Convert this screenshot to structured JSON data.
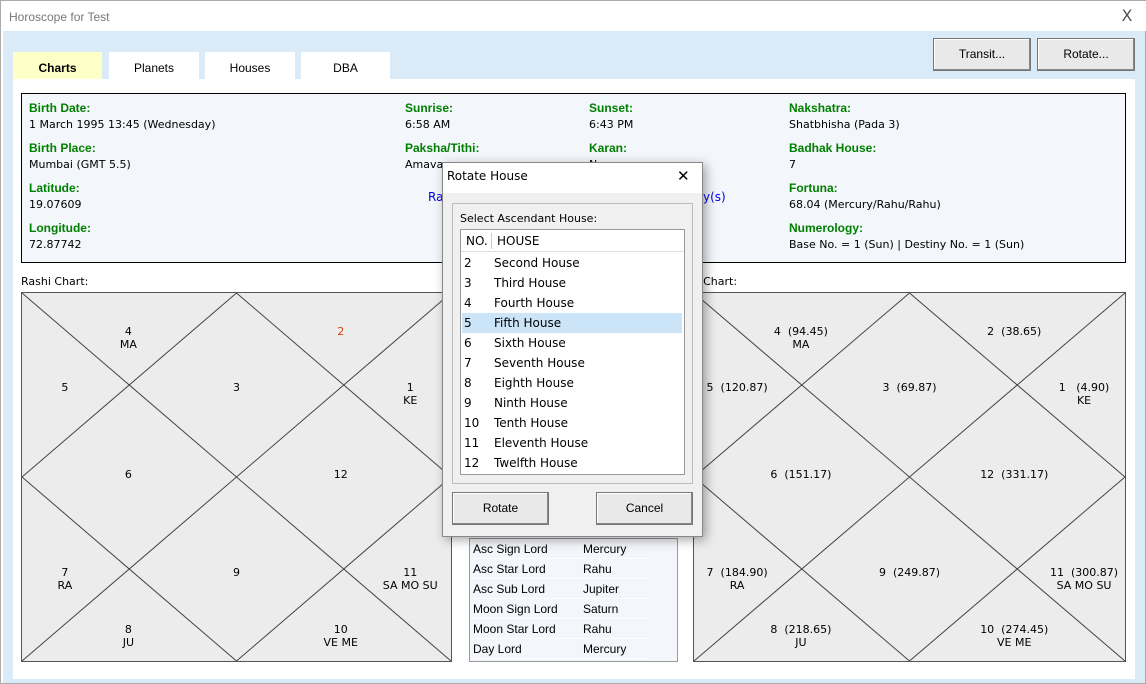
{
  "window": {
    "title": "Horoscope for Test",
    "close": "X"
  },
  "tabs": [
    {
      "label": "Charts",
      "active": true
    },
    {
      "label": "Planets"
    },
    {
      "label": "Houses"
    },
    {
      "label": "DBA"
    }
  ],
  "buttons": {
    "transit": "Transit...",
    "rotate": "Rotate..."
  },
  "info": [
    {
      "label": "Birth Date:",
      "value": "1 March 1995 13:45 (Wednesday)"
    },
    {
      "label": "Birth Place:",
      "value": "Mumbai (GMT 5.5)"
    },
    {
      "label": "Latitude:",
      "value": "19.07609"
    },
    {
      "label": "Longitude:",
      "value": "72.87742"
    },
    {
      "label": "Sunrise:",
      "value": "6:58 AM"
    },
    {
      "label": "Paksha/Tithi:",
      "value": "Amavas"
    },
    {
      "label": "Sunset:",
      "value": "6:43 PM"
    },
    {
      "label": "Karan:",
      "value": "N"
    },
    {
      "label": "Nakshatra:",
      "value": "Shatbhisha (Pada 3)"
    },
    {
      "label": "Badhak House:",
      "value": "7"
    },
    {
      "label": "Fortuna:",
      "value": "68.04 (Mercury/Rahu/Rahu)"
    },
    {
      "label": "Numerology:",
      "value": "Base No. = 1 (Sun)  |  Destiny No. = 1 (Sun)"
    }
  ],
  "links": {
    "left_fragment": "Ra",
    "right_fragment": "y(s)"
  },
  "rashi": {
    "label": "Rashi Chart:",
    "asc_color": "#e04000",
    "houses": {
      "1": "1\nKE",
      "2": "2",
      "3": "3",
      "4": "4\nMA",
      "5": "5",
      "6": "6",
      "7": "7\nRA",
      "8": "8\nJU",
      "9": "9",
      "10": "10\nVE ME",
      "11": "11\nSA MO SU",
      "12": "12"
    }
  },
  "kp": {
    "label": "P Chart:",
    "houses": {
      "1": "1   (4.90)\nKE",
      "2": "2  (38.65)",
      "3": "3  (69.87)",
      "4": "4  (94.45)\nMA",
      "5": "5  (120.87)",
      "6": "6  (151.17)",
      "7": "7  (184.90)\nRA",
      "8": "8  (218.65)\nJU",
      "9": "9  (249.87)",
      "10": "10  (274.45)\nVE ME",
      "11": "11  (300.87)\nSA MO SU",
      "12": "12  (331.17)"
    }
  },
  "lords": [
    {
      "k": "Asc Sign Lord",
      "v": "Mercury"
    },
    {
      "k": "Asc Star Lord",
      "v": "Rahu"
    },
    {
      "k": "Asc Sub Lord",
      "v": "Jupiter"
    },
    {
      "k": "Moon Sign Lord",
      "v": "Saturn"
    },
    {
      "k": "Moon Star Lord",
      "v": "Rahu"
    },
    {
      "k": "Day Lord",
      "v": "Mercury"
    }
  ],
  "dialog": {
    "title": "Rotate House",
    "close": "✕",
    "group_label": "Select Ascendant House:",
    "col_no": "NO.",
    "col_house": "HOUSE",
    "rows": [
      {
        "n": "2",
        "t": "Second House"
      },
      {
        "n": "3",
        "t": "Third House"
      },
      {
        "n": "4",
        "t": "Fourth House"
      },
      {
        "n": "5",
        "t": "Fifth House",
        "selected": true
      },
      {
        "n": "6",
        "t": "Sixth House"
      },
      {
        "n": "7",
        "t": "Seventh House"
      },
      {
        "n": "8",
        "t": "Eighth House"
      },
      {
        "n": "9",
        "t": "Ninth House"
      },
      {
        "n": "10",
        "t": "Tenth House"
      },
      {
        "n": "11",
        "t": "Eleventh House"
      },
      {
        "n": "12",
        "t": "Twelfth House"
      }
    ],
    "rotate": "Rotate",
    "cancel": "Cancel"
  }
}
